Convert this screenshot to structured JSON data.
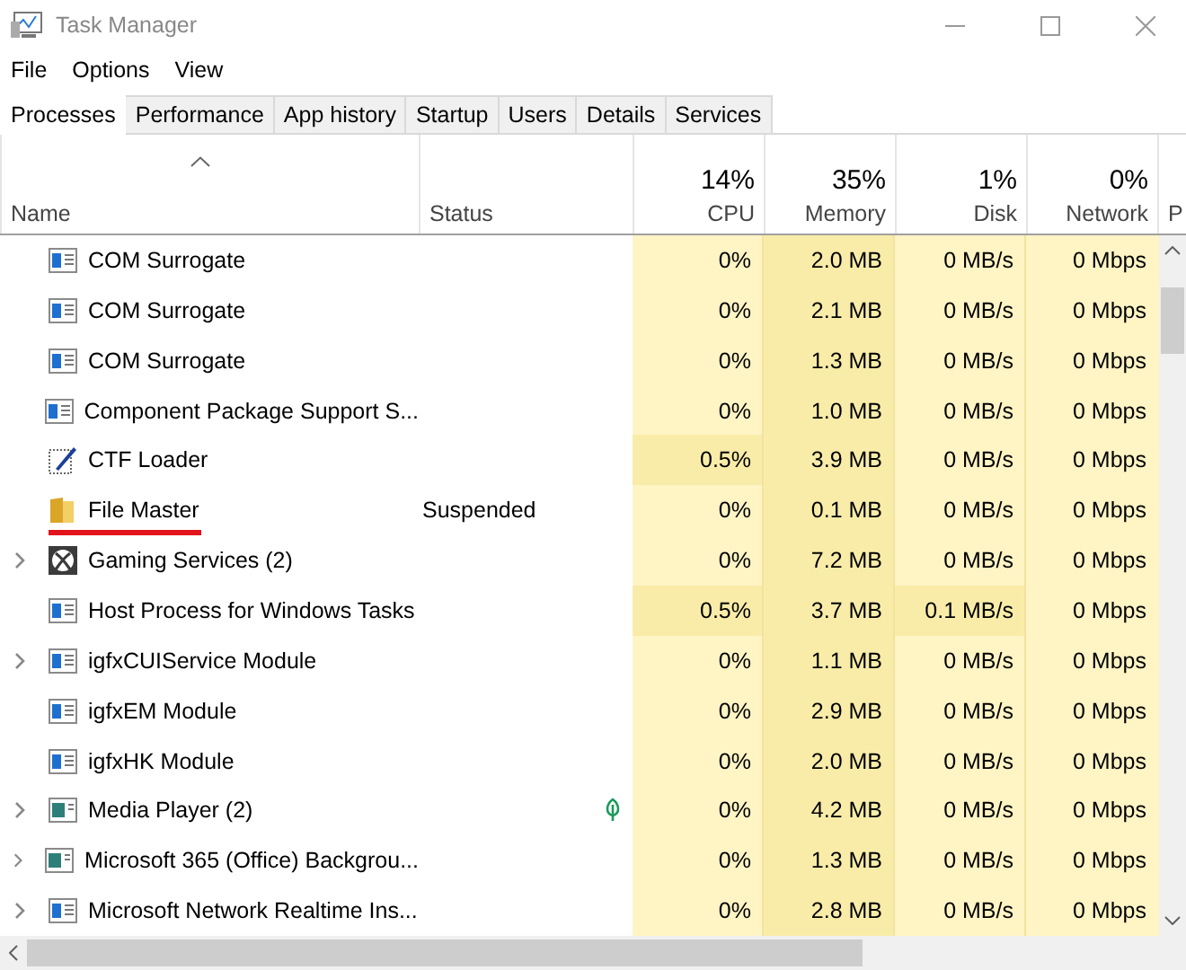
{
  "window": {
    "title": "Task Manager"
  },
  "menu": [
    "File",
    "Options",
    "View"
  ],
  "tabs": [
    {
      "label": "Processes",
      "selected": true
    },
    {
      "label": "Performance",
      "selected": false
    },
    {
      "label": "App history",
      "selected": false
    },
    {
      "label": "Startup",
      "selected": false
    },
    {
      "label": "Users",
      "selected": false
    },
    {
      "label": "Details",
      "selected": false
    },
    {
      "label": "Services",
      "selected": false
    }
  ],
  "columns": [
    {
      "label": "Name",
      "sorted": true
    },
    {
      "label": "Status",
      "sorted": false
    },
    {
      "label": "CPU",
      "percent": "14%",
      "sorted": false
    },
    {
      "label": "Memory",
      "percent": "35%",
      "sorted": false
    },
    {
      "label": "Disk",
      "percent": "1%",
      "sorted": false
    },
    {
      "label": "Network",
      "percent": "0%",
      "sorted": false
    },
    {
      "label": "P",
      "sorted": false
    }
  ],
  "rows": [
    {
      "kind": "window",
      "name": "COM Surrogate",
      "expandable": false,
      "underlined": false,
      "eco": false,
      "cpu": {
        "text": "0%",
        "hot": false
      },
      "memory": {
        "text": "2.0 MB",
        "hot": true
      },
      "disk": {
        "text": "0 MB/s",
        "hot": false
      },
      "network": {
        "text": "0 Mbps",
        "hot": false
      }
    },
    {
      "kind": "window",
      "name": "COM Surrogate",
      "expandable": false,
      "underlined": false,
      "eco": false,
      "cpu": {
        "text": "0%",
        "hot": false
      },
      "memory": {
        "text": "2.1 MB",
        "hot": true
      },
      "disk": {
        "text": "0 MB/s",
        "hot": false
      },
      "network": {
        "text": "0 Mbps",
        "hot": false
      }
    },
    {
      "kind": "window",
      "name": "COM Surrogate",
      "expandable": false,
      "underlined": false,
      "eco": false,
      "cpu": {
        "text": "0%",
        "hot": false
      },
      "memory": {
        "text": "1.3 MB",
        "hot": true
      },
      "disk": {
        "text": "0 MB/s",
        "hot": false
      },
      "network": {
        "text": "0 Mbps",
        "hot": false
      }
    },
    {
      "kind": "window",
      "name": "Component Package Support S...",
      "expandable": false,
      "underlined": false,
      "eco": false,
      "cpu": {
        "text": "0%",
        "hot": false
      },
      "memory": {
        "text": "1.0 MB",
        "hot": true
      },
      "disk": {
        "text": "0 MB/s",
        "hot": false
      },
      "network": {
        "text": "0 Mbps",
        "hot": false
      }
    },
    {
      "kind": "pen",
      "name": "CTF Loader",
      "expandable": false,
      "underlined": false,
      "eco": false,
      "cpu": {
        "text": "0.5%",
        "hot": true
      },
      "memory": {
        "text": "3.9 MB",
        "hot": true
      },
      "disk": {
        "text": "0 MB/s",
        "hot": false
      },
      "network": {
        "text": "0 Mbps",
        "hot": false
      }
    },
    {
      "kind": "folder",
      "name": "File Master",
      "status": "Suspended",
      "expandable": false,
      "underlined": true,
      "eco": false,
      "cpu": {
        "text": "0%",
        "hot": false
      },
      "memory": {
        "text": "0.1 MB",
        "hot": true
      },
      "disk": {
        "text": "0 MB/s",
        "hot": false
      },
      "network": {
        "text": "0 Mbps",
        "hot": false
      }
    },
    {
      "kind": "xbox",
      "name": "Gaming Services (2)",
      "expandable": true,
      "underlined": false,
      "eco": false,
      "cpu": {
        "text": "0%",
        "hot": false
      },
      "memory": {
        "text": "7.2 MB",
        "hot": true
      },
      "disk": {
        "text": "0 MB/s",
        "hot": false
      },
      "network": {
        "text": "0 Mbps",
        "hot": false
      }
    },
    {
      "kind": "window",
      "name": "Host Process for Windows Tasks",
      "expandable": false,
      "underlined": false,
      "eco": false,
      "cpu": {
        "text": "0.5%",
        "hot": true
      },
      "memory": {
        "text": "3.7 MB",
        "hot": true
      },
      "disk": {
        "text": "0.1 MB/s",
        "hot": true
      },
      "network": {
        "text": "0 Mbps",
        "hot": false
      }
    },
    {
      "kind": "window",
      "name": "igfxCUIService Module",
      "expandable": true,
      "underlined": false,
      "eco": false,
      "cpu": {
        "text": "0%",
        "hot": false
      },
      "memory": {
        "text": "1.1 MB",
        "hot": true
      },
      "disk": {
        "text": "0 MB/s",
        "hot": false
      },
      "network": {
        "text": "0 Mbps",
        "hot": false
      }
    },
    {
      "kind": "window",
      "name": "igfxEM Module",
      "expandable": false,
      "underlined": false,
      "eco": false,
      "cpu": {
        "text": "0%",
        "hot": false
      },
      "memory": {
        "text": "2.9 MB",
        "hot": true
      },
      "disk": {
        "text": "0 MB/s",
        "hot": false
      },
      "network": {
        "text": "0 Mbps",
        "hot": false
      }
    },
    {
      "kind": "window",
      "name": "igfxHK Module",
      "expandable": false,
      "underlined": false,
      "eco": false,
      "cpu": {
        "text": "0%",
        "hot": false
      },
      "memory": {
        "text": "2.0 MB",
        "hot": true
      },
      "disk": {
        "text": "0 MB/s",
        "hot": false
      },
      "network": {
        "text": "0 Mbps",
        "hot": false
      }
    },
    {
      "kind": "media",
      "name": "Media Player (2)",
      "expandable": true,
      "underlined": false,
      "eco": true,
      "cpu": {
        "text": "0%",
        "hot": false
      },
      "memory": {
        "text": "4.2 MB",
        "hot": true
      },
      "disk": {
        "text": "0 MB/s",
        "hot": false
      },
      "network": {
        "text": "0 Mbps",
        "hot": false
      }
    },
    {
      "kind": "media",
      "name": "Microsoft 365 (Office) Backgrou...",
      "expandable": true,
      "underlined": false,
      "eco": false,
      "cpu": {
        "text": "0%",
        "hot": false
      },
      "memory": {
        "text": "1.3 MB",
        "hot": true
      },
      "disk": {
        "text": "0 MB/s",
        "hot": false
      },
      "network": {
        "text": "0 Mbps",
        "hot": false
      }
    },
    {
      "kind": "window",
      "name": "Microsoft Network Realtime Ins...",
      "expandable": true,
      "underlined": false,
      "eco": false,
      "cpu": {
        "text": "0%",
        "hot": false
      },
      "memory": {
        "text": "2.8 MB",
        "hot": true
      },
      "disk": {
        "text": "0 MB/s",
        "hot": false
      },
      "network": {
        "text": "0 Mbps",
        "hot": false
      }
    }
  ]
}
